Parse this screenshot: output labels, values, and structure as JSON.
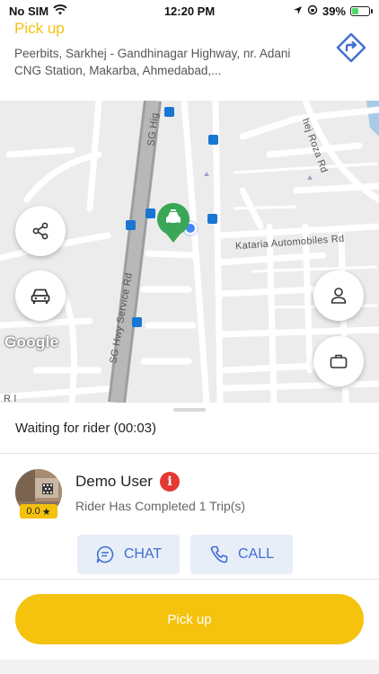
{
  "status_bar": {
    "carrier": "No SIM",
    "time": "12:20 PM",
    "battery": "39%",
    "battery_level": 0.39
  },
  "header": {
    "title": "Pick up",
    "address": "Peerbits, Sarkhej - Gandhinagar Highway, nr. Adani CNG Station, Makarba, Ahmedabad,..."
  },
  "map": {
    "labels": {
      "sg_highway": "SG Hig",
      "roza_rd": "hej Roza Rd",
      "kataria": "Kataria Automobiles Rd",
      "service_rd": "SG Hwy Service Rd",
      "bottom_left": "R   l"
    },
    "attribution": "Google"
  },
  "sheet": {
    "status": "Waiting for rider (00:03)",
    "rider": {
      "name": "Demo User",
      "rating": "0.0",
      "rating_star": "★",
      "info_badge": "i",
      "trips": "Rider Has Completed 1 Trip(s)"
    },
    "chat_label": "CHAT",
    "call_label": "CALL",
    "primary_action": "Pick up"
  },
  "colors": {
    "accent_yellow": "#f5c20e",
    "action_blue": "#3f6fd3",
    "alert_red": "#e53935",
    "map_marker_green": "#3aa757"
  }
}
